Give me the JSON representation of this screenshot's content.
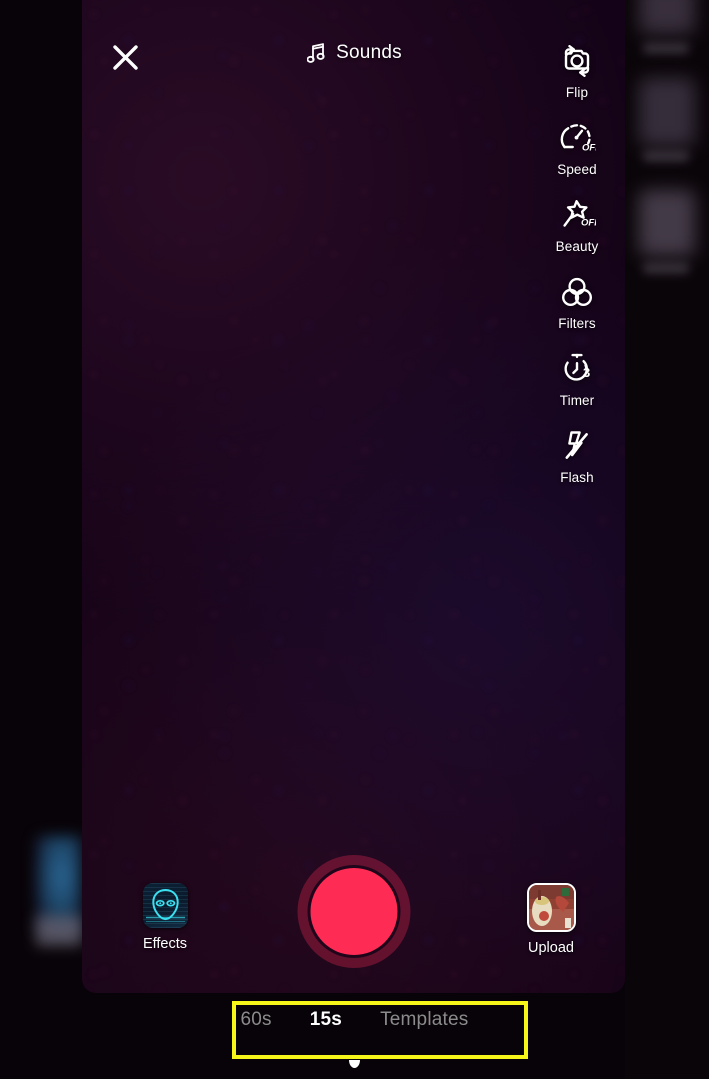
{
  "screen": {
    "app": "TikTok Camera",
    "viewport_bg": "#140318",
    "page_bg": "#000000"
  },
  "topbar": {
    "close_icon": "close-x-icon",
    "sounds_icon": "music-note-icon",
    "sounds_label": "Sounds"
  },
  "rail": {
    "items": [
      {
        "icon": "camera-flip-icon",
        "label": "Flip",
        "badge": ""
      },
      {
        "icon": "speedometer-icon",
        "label": "Speed",
        "badge": "OFF"
      },
      {
        "icon": "magic-wand-icon",
        "label": "Beauty",
        "badge": "OFF"
      },
      {
        "icon": "filters-circles-icon",
        "label": "Filters",
        "badge": ""
      },
      {
        "icon": "stopwatch-icon",
        "label": "Timer",
        "badge": "3"
      },
      {
        "icon": "flash-off-icon",
        "label": "Flash",
        "badge": ""
      }
    ]
  },
  "capture": {
    "effects_label": "Effects",
    "effects_icon": "alien-face-icon",
    "upload_label": "Upload",
    "upload_icon": "gallery-thumbnail",
    "record_icon": "record-button",
    "record_color": "#fe2c55"
  },
  "modes": {
    "tabs": [
      {
        "label": "60s",
        "selected": false
      },
      {
        "label": "15s",
        "selected": true
      },
      {
        "label": "Templates",
        "selected": false
      }
    ],
    "selected_indicator": "mode-dot"
  },
  "annotation": {
    "highlight_color": "#f5f51a",
    "target": "mode-selector-bar"
  }
}
